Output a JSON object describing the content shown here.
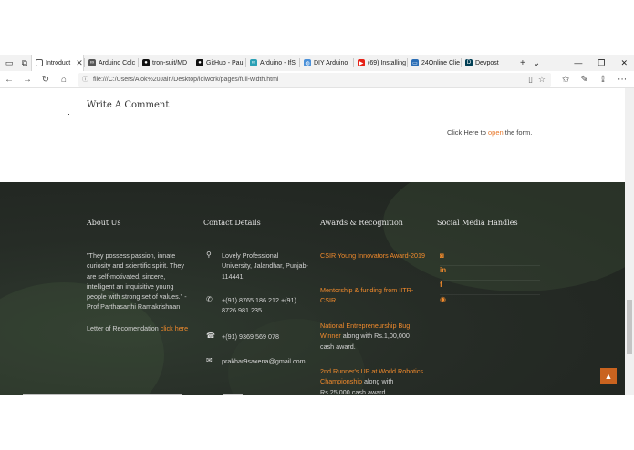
{
  "browser": {
    "tabs": [
      {
        "label": "Introduct",
        "favicon": "page",
        "active": true,
        "color": "#ffffff"
      },
      {
        "label": "Arduino Colc",
        "favicon": "arduino",
        "color": "#555555"
      },
      {
        "label": "tron-suit/MD",
        "favicon": "github",
        "color": "#111111"
      },
      {
        "label": "GitHub - Pau",
        "favicon": "github",
        "color": "#111111"
      },
      {
        "label": "Arduino - IfS",
        "favicon": "arduino",
        "color": "#2aa0b5"
      },
      {
        "label": "DIY Arduino",
        "favicon": "globe",
        "color": "#4a90d9"
      },
      {
        "label": "(69) Installing",
        "favicon": "youtube",
        "color": "#e62117"
      },
      {
        "label": "24Online Clie",
        "favicon": "page",
        "color": "#2a6db5"
      },
      {
        "label": "Devpost",
        "favicon": "devpost",
        "color": "#003e54"
      }
    ],
    "tab_close": "✕",
    "new_tab": "+",
    "tab_menu": "⌄",
    "window": {
      "minimize": "—",
      "maximize": "❐",
      "close": "✕"
    },
    "nav": {
      "back": "←",
      "forward": "→",
      "refresh": "↻",
      "home": "⌂"
    },
    "url": "file:///C:/Users/Alok%20Jain/Desktop/lolwork/pages/full-width.html",
    "url_icons": {
      "info": "ⓘ",
      "reading": "▯",
      "favorite": "☆"
    },
    "toolbar_icons": {
      "favorites": "✩",
      "notes": "✎",
      "share": "⇪",
      "more": "⋯"
    }
  },
  "page": {
    "comment_title": "Write A Comment",
    "click_here_prefix": "Click Here to ",
    "click_here_link": "open",
    "click_here_suffix": " the form."
  },
  "footer": {
    "about": {
      "heading": "About Us",
      "quote": "\"They possess passion, innate curiosity and scientific spirit. They are self-motivated, sincere, intelligent an inquisitive young people with strong set of values.\" - Prof Parthasarthi Ramakrishnan",
      "lor_text": "Letter of Recomendation ",
      "lor_link": "click here"
    },
    "contact": {
      "heading": "Contact Details",
      "address": "Lovely Professional University, Jalandhar, Punjab-114441.",
      "phones": "+(91) 8765 186 212 +(91) 8726 981 235",
      "fax": "+(91) 9369 569 078",
      "email": "prakhar9saxena@gmail.com",
      "icons": {
        "address": "⚲",
        "phone": "✆",
        "fax": "☎",
        "email": "✉"
      }
    },
    "awards": {
      "heading": "Awards & Recognition",
      "items": [
        {
          "link": "CSIR Young Innovators Award-2019",
          "text": ""
        },
        {
          "link": "Mentorship & funding from IITR-CSIR",
          "text": ""
        },
        {
          "link": "National Entrepreneurship Bug Winner",
          "text": " along with Rs.1,00,000 cash award."
        },
        {
          "link": "2nd Runner's UP at World Robotics Championship",
          "text": " along with Rs.25,000 cash award."
        }
      ]
    },
    "social": {
      "heading": "Social Media Handles",
      "icons": {
        "instagram": "◙",
        "linkedin": "in",
        "facebook": "f",
        "github": "◉"
      }
    },
    "scroll_top": "▲"
  },
  "colors": {
    "accent": "#f18a2c",
    "footer_bg": "#262c26"
  }
}
